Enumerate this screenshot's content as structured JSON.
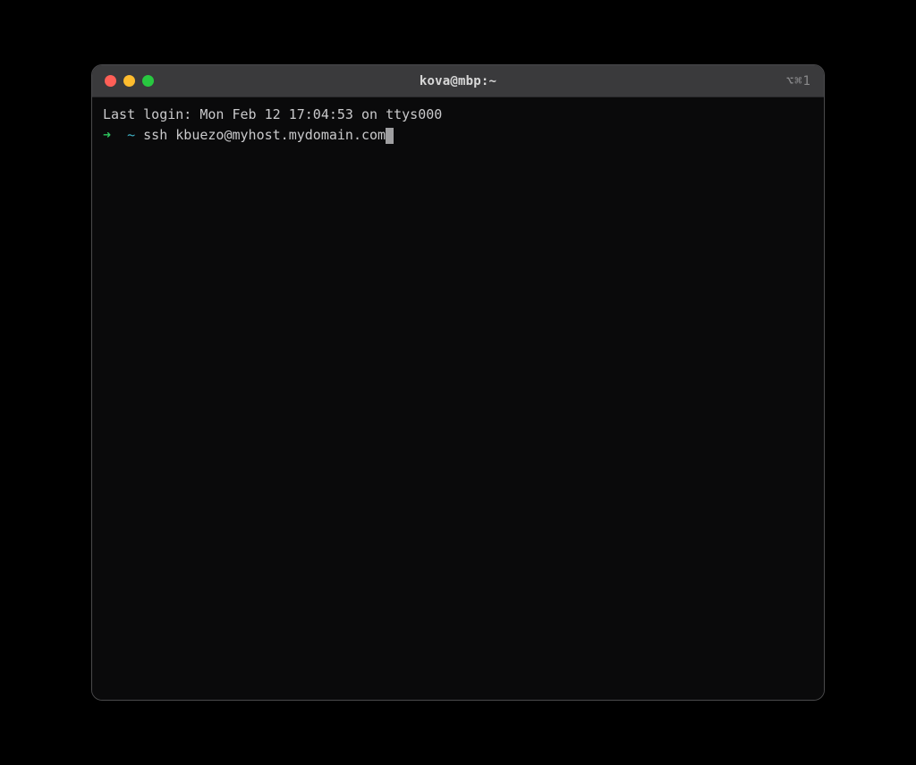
{
  "window": {
    "title": "kova@mbp:~",
    "shortcut": "⌥⌘1"
  },
  "terminal": {
    "last_login": "Last login: Mon Feb 12 17:04:53 on ttys000",
    "prompt": {
      "arrow": "➜",
      "path": "~"
    },
    "command": "ssh kbuezo@myhost.mydomain.com"
  }
}
